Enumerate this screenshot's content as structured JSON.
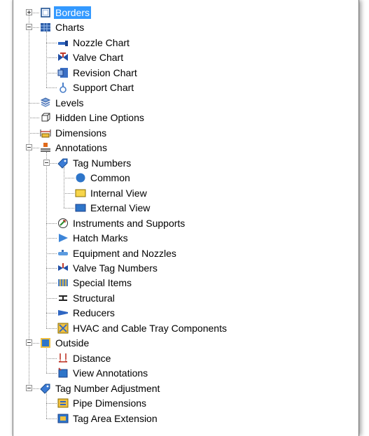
{
  "tree": {
    "items": [
      {
        "label": "Borders",
        "icon": "borders-icon",
        "level": 0,
        "expander": "plus",
        "selected": true
      },
      {
        "label": "Charts",
        "icon": "charts-icon",
        "level": 0,
        "expander": "minus"
      },
      {
        "label": "Nozzle Chart",
        "icon": "nozzle-chart-icon",
        "level": 1
      },
      {
        "label": "Valve Chart",
        "icon": "valve-chart-icon",
        "level": 1
      },
      {
        "label": "Revision Chart",
        "icon": "revision-chart-icon",
        "level": 1
      },
      {
        "label": "Support Chart",
        "icon": "support-chart-icon",
        "level": 1
      },
      {
        "label": "Levels",
        "icon": "levels-icon",
        "level": 0
      },
      {
        "label": "Hidden Line Options",
        "icon": "hidden-line-icon",
        "level": 0
      },
      {
        "label": "Dimensions",
        "icon": "dimensions-icon",
        "level": 0
      },
      {
        "label": "Annotations",
        "icon": "annotations-icon",
        "level": 0,
        "expander": "minus"
      },
      {
        "label": "Tag Numbers",
        "icon": "tag-icon",
        "level": 1,
        "expander": "minus"
      },
      {
        "label": "Common",
        "icon": "circle-icon",
        "level": 2
      },
      {
        "label": "Internal View",
        "icon": "internal-view-icon",
        "level": 2
      },
      {
        "label": "External View",
        "icon": "external-view-icon",
        "level": 2
      },
      {
        "label": "Instruments and Supports",
        "icon": "instrument-icon",
        "level": 1
      },
      {
        "label": "Hatch Marks",
        "icon": "hatch-marks-icon",
        "level": 1
      },
      {
        "label": "Equipment and Nozzles",
        "icon": "equipment-icon",
        "level": 1
      },
      {
        "label": "Valve Tag Numbers",
        "icon": "valve-tag-icon",
        "level": 1
      },
      {
        "label": "Special Items",
        "icon": "special-items-icon",
        "level": 1
      },
      {
        "label": "Structural",
        "icon": "structural-icon",
        "level": 1
      },
      {
        "label": "Reducers",
        "icon": "reducers-icon",
        "level": 1
      },
      {
        "label": "HVAC and Cable Tray Components",
        "icon": "hvac-icon",
        "level": 1
      },
      {
        "label": "Outside",
        "icon": "outside-icon",
        "level": 0,
        "expander": "minus"
      },
      {
        "label": "Distance",
        "icon": "distance-icon",
        "level": 1
      },
      {
        "label": "View Annotations",
        "icon": "view-annotations-icon",
        "level": 1
      },
      {
        "label": "Tag Number Adjustment",
        "icon": "tag-icon",
        "level": 0,
        "expander": "minus"
      },
      {
        "label": "Pipe Dimensions",
        "icon": "pipe-dimensions-icon",
        "level": 1
      },
      {
        "label": "Tag Area Extension",
        "icon": "tag-area-icon",
        "level": 1
      }
    ]
  },
  "colors": {
    "selection": "#3399ff",
    "tree_line": "#8c8c8c"
  }
}
